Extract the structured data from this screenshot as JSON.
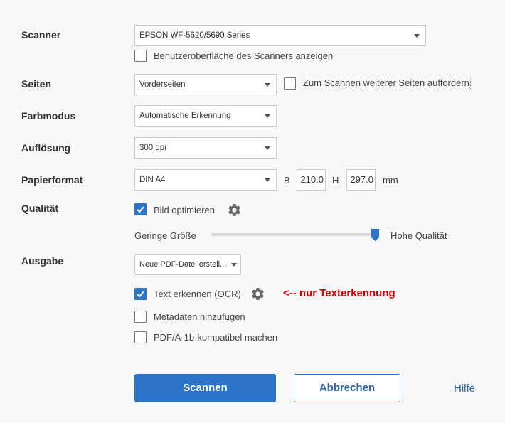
{
  "scanner": {
    "label": "Scanner",
    "value": "EPSON WF-5620/5690 Series",
    "show_ui_label": "Benutzeroberfläche des Scanners anzeigen",
    "show_ui_checked": false
  },
  "pages": {
    "label": "Seiten",
    "value": "Vorderseiten",
    "prompt_label": "Zum Scannen weiterer Seiten auffordern",
    "prompt_checked": false
  },
  "color_mode": {
    "label": "Farbmodus",
    "value": "Automatische Erkennung"
  },
  "resolution": {
    "label": "Auflösung",
    "value": "300 dpi"
  },
  "paper": {
    "label": "Papierformat",
    "value": "DIN A4",
    "width_label": "B",
    "width_value": "210.0",
    "height_label": "H",
    "height_value": "297.0",
    "unit": "mm"
  },
  "quality": {
    "label": "Qualität",
    "optimize_label": "Bild optimieren",
    "optimize_checked": true,
    "min_label": "Geringe Größe",
    "max_label": "Hohe Qualität",
    "slider_value": 1.0
  },
  "output": {
    "label": "Ausgabe",
    "value": "Neue PDF-Datei erstell...",
    "ocr_label": "Text erkennen (OCR)",
    "ocr_checked": true,
    "annotation": "<-- nur Texterkennung",
    "annotation_color": "#d40000",
    "metadata_label": "Metadaten hinzufügen",
    "metadata_checked": false,
    "pdfa_label": "PDF/A-1b-kompatibel machen",
    "pdfa_checked": false
  },
  "buttons": {
    "scan": "Scannen",
    "cancel": "Abbrechen",
    "help": "Hilfe"
  },
  "colors": {
    "accent": "#2c74c9",
    "button_text": "#2a62a8"
  },
  "icons": {
    "settings": "gear-icon",
    "dropdown": "chevron-down-icon",
    "check": "checkmark-icon"
  }
}
